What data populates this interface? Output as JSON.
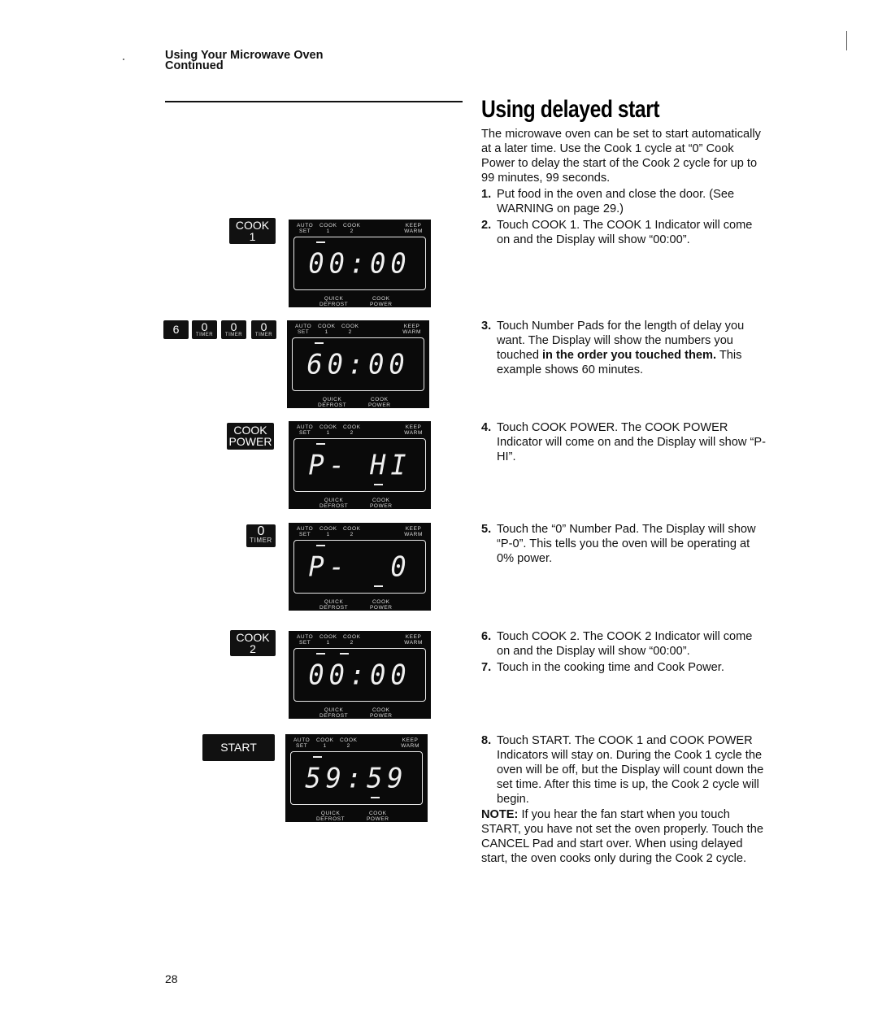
{
  "header": {
    "section_line1": "Using Your Microwave Oven",
    "section_line2": "Continued"
  },
  "title": "Using delayed start",
  "intro": "The microwave oven can be set to start automatically at a later time. Use the Cook 1 cycle at “0” Cook Power to delay the start of the Cook 2 cycle for up to 99 minutes, 99 seconds.",
  "steps": [
    {
      "num": "1.",
      "text": "Put food in the oven and close the door. (See WARNING on page 29.)"
    },
    {
      "num": "2.",
      "text": "Touch COOK 1. The COOK 1 Indicator will come on and the Display will show “00:00”."
    },
    {
      "num": "3.",
      "text_before": "Touch Number Pads for the length of delay you want. The Display will show the numbers you touched ",
      "text_bold": "in the order you touched them.",
      "text_after": " This example shows 60 minutes."
    },
    {
      "num": "4.",
      "text": "Touch COOK POWER. The COOK POWER Indicator will come on and the Display will show “P-HI”."
    },
    {
      "num": "5.",
      "text": "Touch the “0” Number Pad. The Display will show “P-0”. This tells you the oven will be operating at 0% power."
    },
    {
      "num": "6.",
      "text": "Touch COOK 2. The COOK 2 Indicator will come on and the Display will show “00:00”."
    },
    {
      "num": "7.",
      "text": "Touch in the cooking time and Cook Power."
    },
    {
      "num": "8.",
      "text": "Touch START. The COOK 1 and COOK POWER Indicators will stay on. During the Cook 1 cycle the oven will be off, but the Display will count down the set time. After this time is up, the Cook 2 cycle will begin."
    }
  ],
  "note": {
    "label": "NOTE:",
    "text": " If you hear the fan start when you touch START, you have not set the oven properly. Touch the CANCEL Pad and start over. When using delayed start, the oven cooks only during the Cook 2 cycle."
  },
  "panel_labels": {
    "auto_set": "AUTO\nSET",
    "cook1": "COOK\n1",
    "cook2": "COOK\n2",
    "keep_warm": "KEEP\nWARM",
    "quick_defrost": "QUICK\nDEFROST",
    "cook_power": "COOK\nPOWER"
  },
  "pads": {
    "cook1": {
      "line1": "COOK",
      "line2": "1"
    },
    "number6": {
      "line1": "6"
    },
    "number0_timer": {
      "line1": "0",
      "line2": "TIMER"
    },
    "cook_power": {
      "line1": "COOK",
      "line2": "POWER"
    },
    "cook2": {
      "line1": "COOK",
      "line2": "2"
    },
    "start": {
      "line1": "START"
    }
  },
  "displays": [
    {
      "readout": "00:00",
      "indicators": [
        "cook1"
      ]
    },
    {
      "readout": "60:00",
      "indicators": [
        "cook1"
      ]
    },
    {
      "readout": "P- HI",
      "indicators": [
        "cook1",
        "cook_power"
      ]
    },
    {
      "readout": "P-  0",
      "indicators": [
        "cook1",
        "cook_power"
      ]
    },
    {
      "readout": "00:00",
      "indicators": [
        "cook1",
        "cook2"
      ]
    },
    {
      "readout": "59:59",
      "indicators": [
        "cook1",
        "cook_power"
      ]
    }
  ],
  "page_number": "28"
}
